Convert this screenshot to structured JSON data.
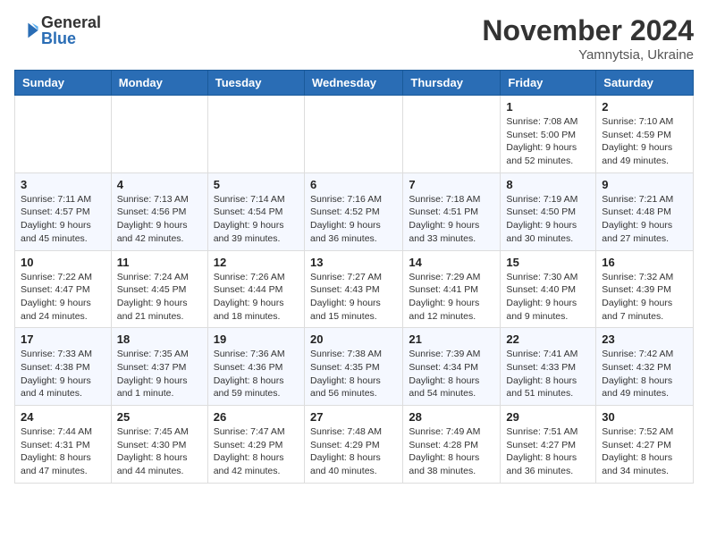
{
  "logo": {
    "general": "General",
    "blue": "Blue"
  },
  "title": {
    "month": "November 2024",
    "location": "Yamnytsia, Ukraine"
  },
  "headers": [
    "Sunday",
    "Monday",
    "Tuesday",
    "Wednesday",
    "Thursday",
    "Friday",
    "Saturday"
  ],
  "weeks": [
    [
      {
        "day": "",
        "info": ""
      },
      {
        "day": "",
        "info": ""
      },
      {
        "day": "",
        "info": ""
      },
      {
        "day": "",
        "info": ""
      },
      {
        "day": "",
        "info": ""
      },
      {
        "day": "1",
        "info": "Sunrise: 7:08 AM\nSunset: 5:00 PM\nDaylight: 9 hours\nand 52 minutes."
      },
      {
        "day": "2",
        "info": "Sunrise: 7:10 AM\nSunset: 4:59 PM\nDaylight: 9 hours\nand 49 minutes."
      }
    ],
    [
      {
        "day": "3",
        "info": "Sunrise: 7:11 AM\nSunset: 4:57 PM\nDaylight: 9 hours\nand 45 minutes."
      },
      {
        "day": "4",
        "info": "Sunrise: 7:13 AM\nSunset: 4:56 PM\nDaylight: 9 hours\nand 42 minutes."
      },
      {
        "day": "5",
        "info": "Sunrise: 7:14 AM\nSunset: 4:54 PM\nDaylight: 9 hours\nand 39 minutes."
      },
      {
        "day": "6",
        "info": "Sunrise: 7:16 AM\nSunset: 4:52 PM\nDaylight: 9 hours\nand 36 minutes."
      },
      {
        "day": "7",
        "info": "Sunrise: 7:18 AM\nSunset: 4:51 PM\nDaylight: 9 hours\nand 33 minutes."
      },
      {
        "day": "8",
        "info": "Sunrise: 7:19 AM\nSunset: 4:50 PM\nDaylight: 9 hours\nand 30 minutes."
      },
      {
        "day": "9",
        "info": "Sunrise: 7:21 AM\nSunset: 4:48 PM\nDaylight: 9 hours\nand 27 minutes."
      }
    ],
    [
      {
        "day": "10",
        "info": "Sunrise: 7:22 AM\nSunset: 4:47 PM\nDaylight: 9 hours\nand 24 minutes."
      },
      {
        "day": "11",
        "info": "Sunrise: 7:24 AM\nSunset: 4:45 PM\nDaylight: 9 hours\nand 21 minutes."
      },
      {
        "day": "12",
        "info": "Sunrise: 7:26 AM\nSunset: 4:44 PM\nDaylight: 9 hours\nand 18 minutes."
      },
      {
        "day": "13",
        "info": "Sunrise: 7:27 AM\nSunset: 4:43 PM\nDaylight: 9 hours\nand 15 minutes."
      },
      {
        "day": "14",
        "info": "Sunrise: 7:29 AM\nSunset: 4:41 PM\nDaylight: 9 hours\nand 12 minutes."
      },
      {
        "day": "15",
        "info": "Sunrise: 7:30 AM\nSunset: 4:40 PM\nDaylight: 9 hours\nand 9 minutes."
      },
      {
        "day": "16",
        "info": "Sunrise: 7:32 AM\nSunset: 4:39 PM\nDaylight: 9 hours\nand 7 minutes."
      }
    ],
    [
      {
        "day": "17",
        "info": "Sunrise: 7:33 AM\nSunset: 4:38 PM\nDaylight: 9 hours\nand 4 minutes."
      },
      {
        "day": "18",
        "info": "Sunrise: 7:35 AM\nSunset: 4:37 PM\nDaylight: 9 hours\nand 1 minute."
      },
      {
        "day": "19",
        "info": "Sunrise: 7:36 AM\nSunset: 4:36 PM\nDaylight: 8 hours\nand 59 minutes."
      },
      {
        "day": "20",
        "info": "Sunrise: 7:38 AM\nSunset: 4:35 PM\nDaylight: 8 hours\nand 56 minutes."
      },
      {
        "day": "21",
        "info": "Sunrise: 7:39 AM\nSunset: 4:34 PM\nDaylight: 8 hours\nand 54 minutes."
      },
      {
        "day": "22",
        "info": "Sunrise: 7:41 AM\nSunset: 4:33 PM\nDaylight: 8 hours\nand 51 minutes."
      },
      {
        "day": "23",
        "info": "Sunrise: 7:42 AM\nSunset: 4:32 PM\nDaylight: 8 hours\nand 49 minutes."
      }
    ],
    [
      {
        "day": "24",
        "info": "Sunrise: 7:44 AM\nSunset: 4:31 PM\nDaylight: 8 hours\nand 47 minutes."
      },
      {
        "day": "25",
        "info": "Sunrise: 7:45 AM\nSunset: 4:30 PM\nDaylight: 8 hours\nand 44 minutes."
      },
      {
        "day": "26",
        "info": "Sunrise: 7:47 AM\nSunset: 4:29 PM\nDaylight: 8 hours\nand 42 minutes."
      },
      {
        "day": "27",
        "info": "Sunrise: 7:48 AM\nSunset: 4:29 PM\nDaylight: 8 hours\nand 40 minutes."
      },
      {
        "day": "28",
        "info": "Sunrise: 7:49 AM\nSunset: 4:28 PM\nDaylight: 8 hours\nand 38 minutes."
      },
      {
        "day": "29",
        "info": "Sunrise: 7:51 AM\nSunset: 4:27 PM\nDaylight: 8 hours\nand 36 minutes."
      },
      {
        "day": "30",
        "info": "Sunrise: 7:52 AM\nSunset: 4:27 PM\nDaylight: 8 hours\nand 34 minutes."
      }
    ]
  ]
}
